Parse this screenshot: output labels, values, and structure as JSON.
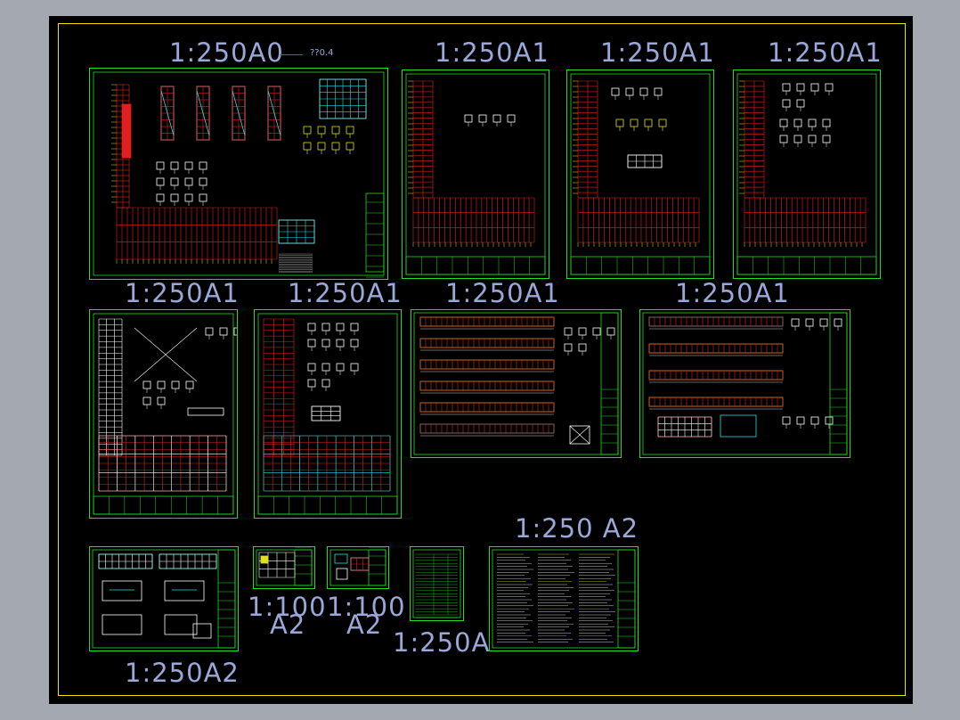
{
  "colors": {
    "background": "#a4a9b1",
    "canvas": "#000000",
    "frame": "#e6e600",
    "sheet_border": "#22dd22",
    "label": "#9aa7d8",
    "structure_red": "#e02020",
    "structure_yellow": "#e0e020",
    "structure_cyan": "#20e0e0",
    "structure_white": "#ffffff"
  },
  "labels": {
    "l1": "1:250A0",
    "l1b": "??0.4",
    "l2": "1:250A1",
    "l3": "1:250A1",
    "l4": "1:250A1",
    "l5": "1:250A1",
    "l6": "1:250A1",
    "l7": "1:250A1",
    "l8": "1:250A1",
    "l9": "1:250  A2",
    "l10": "1:100",
    "l10b": "A2",
    "l11": "1:100",
    "l11b": "A2",
    "l12": "1:250A4",
    "l13": "1:250A2"
  }
}
